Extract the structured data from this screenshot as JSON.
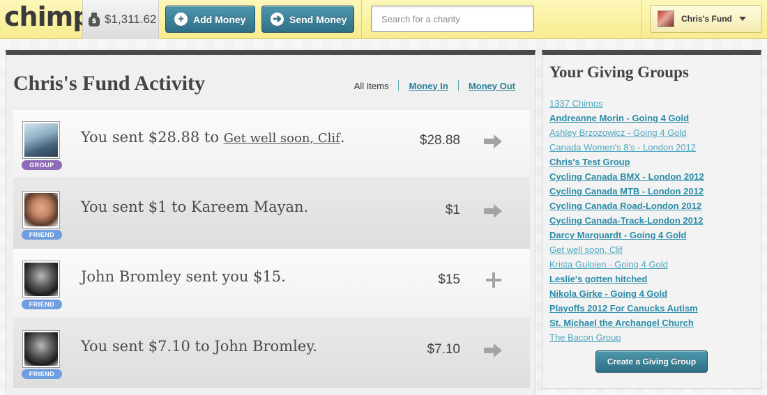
{
  "header": {
    "logo": "chimp",
    "balance": "$1,311.62",
    "bag_symbol": "$",
    "add_money": "Add Money",
    "send_money": "Send Money",
    "add_symbol": "+",
    "send_symbol": "➔",
    "search_placeholder": "Search for a charity",
    "fund_name": "Chris's Fund"
  },
  "main": {
    "title": "Chris's Fund Activity",
    "filters": {
      "all": "All Items",
      "money_in": "Money In",
      "money_out": "Money Out"
    },
    "rows": [
      {
        "prefix": "You sent $28.88 to ",
        "link": "Get well soon, Clif",
        "suffix": ".",
        "amount": "$28.88",
        "badge": "GROUP",
        "action": "arrow"
      },
      {
        "text": "You sent $1 to Kareem Mayan.",
        "amount": "$1",
        "badge": "FRIEND",
        "action": "arrow"
      },
      {
        "text": "John Bromley sent you $15.",
        "amount": "$15",
        "badge": "FRIEND",
        "action": "plus"
      },
      {
        "text": "You sent $7.10 to John Bromley.",
        "amount": "$7.10",
        "badge": "FRIEND",
        "action": "arrow"
      }
    ]
  },
  "sidebar": {
    "title": "Your Giving Groups",
    "groups": [
      "1337 Chimps",
      "Andreanne Morin - Going 4 Gold",
      "Ashley Brzozowicz - Going 4 Gold",
      "Canada Women's 8's - London 2012",
      "Chris's Test Group",
      "Cycling Canada BMX - London 2012",
      "Cycling Canada MTB - London 2012",
      "Cycling Canada Road-London 2012",
      "Cycling Canada-Track-London 2012",
      "Darcy Marquardt - Going 4 Gold",
      "Get well soon, Clif",
      "Krista Guloien - Going 4 Gold",
      "Leslie's gotten hitched",
      "Nikola Girke - Going 4 Gold",
      "Playoffs 2012 For Canucks Autism",
      "St. Michael the Archangel Church",
      "The Bacon Group"
    ],
    "create_button": "Create a Giving Group"
  },
  "colors": {
    "topbar": "#f7ec8f",
    "button_blue": "#2e6f86",
    "link_blue": "#2a8ca8",
    "badge_group": "#8e6bb8",
    "badge_friend": "#6e9de0"
  }
}
